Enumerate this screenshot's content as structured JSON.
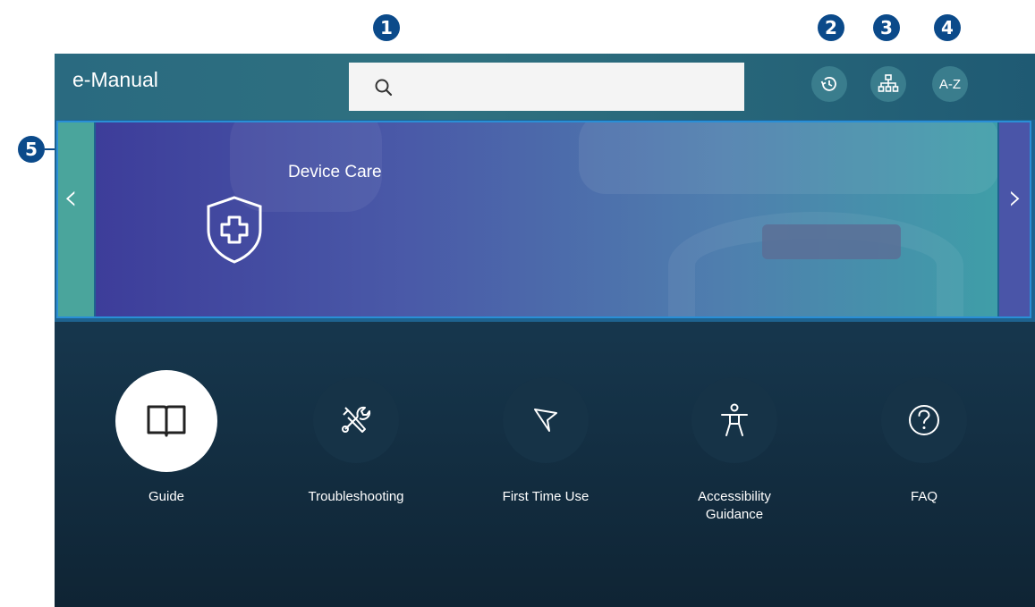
{
  "callouts": [
    "1",
    "2",
    "3",
    "4",
    "5"
  ],
  "header": {
    "title": "e-Manual",
    "search_icon": "search-icon",
    "recent_icon": "history-icon",
    "index_icon": "sitemap-icon",
    "az_label": "A-Z"
  },
  "banner": {
    "title": "Device Care",
    "icon": "shield-plus-icon",
    "prev_icon": "chevron-left-icon",
    "next_icon": "chevron-right-icon",
    "prev_glyph": "‹",
    "next_glyph": "›"
  },
  "menu": [
    {
      "label": "Guide",
      "icon": "book-icon",
      "selected": true
    },
    {
      "label": "Troubleshooting",
      "icon": "tools-icon",
      "selected": false
    },
    {
      "label": "First Time Use",
      "icon": "flag-icon",
      "selected": false
    },
    {
      "label": "Accessibility Guidance",
      "icon": "accessibility-icon",
      "selected": false
    },
    {
      "label": "FAQ",
      "icon": "question-icon",
      "selected": false
    }
  ],
  "colors": {
    "callout": "#0b4a8a",
    "header": "#2a6a80",
    "background": "#17384f",
    "focus_border": "#2a8fd6"
  }
}
